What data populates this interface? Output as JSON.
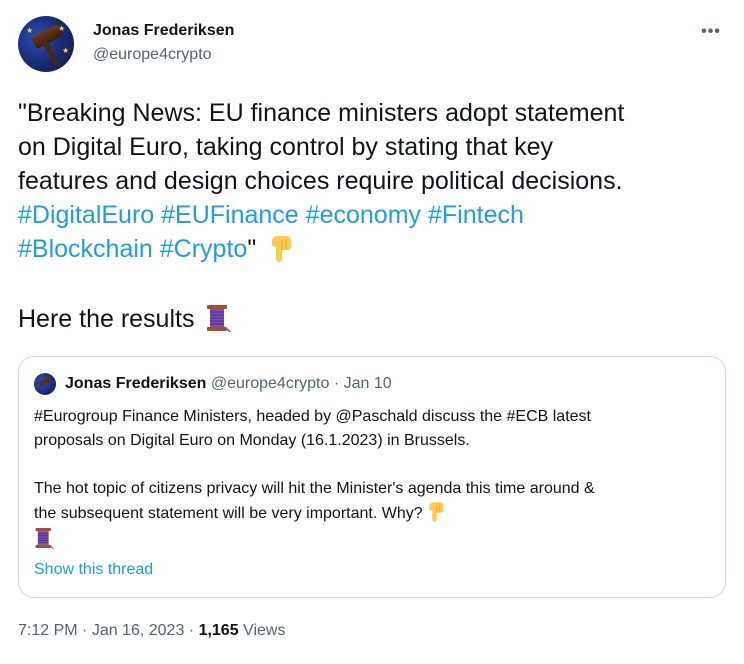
{
  "author": {
    "name": "Jonas Frederiksen",
    "handle": "@europe4crypto"
  },
  "menu": {
    "more_label": "•••"
  },
  "tweet": {
    "line1": "\"Breaking News: EU finance ministers adopt statement",
    "line2": "on Digital Euro, taking control by stating that key",
    "line3": "features and design choices require political decisions.",
    "hashtags_line4": [
      "#DigitalEuro",
      "#EUFinance",
      "#economy",
      "#Fintech"
    ],
    "hashtags_line5": [
      "#Blockchain",
      "#Crypto"
    ],
    "closing_quote": "\"",
    "emoji_1": "backhand-index-pointing-down",
    "results_text": "Here the results",
    "emoji_2": "thread-spool"
  },
  "quoted_tweet": {
    "name": "Jonas Frederiksen",
    "handle": "@europe4crypto",
    "separator": "·",
    "date": "Jan 10",
    "line1": "#Eurogroup Finance Ministers, headed by @Paschald discuss the #ECB latest",
    "line2": "proposals on Digital Euro  on Monday (16.1.2023) in Brussels.",
    "line3": "The hot topic of citizens privacy will hit the Minister's agenda this time around &",
    "line4": "the subsequent statement will be very important. Why?",
    "show_thread": "Show this thread"
  },
  "footer": {
    "time": "7:12 PM",
    "sep1": " · ",
    "date": "Jan 16, 2023",
    "sep2": " · ",
    "views_count": "1,165",
    "views_label": " Views"
  },
  "colors": {
    "accent": "#1d9bf0",
    "text": "#0f1419",
    "secondary": "#536471",
    "border": "#cfd9de"
  }
}
